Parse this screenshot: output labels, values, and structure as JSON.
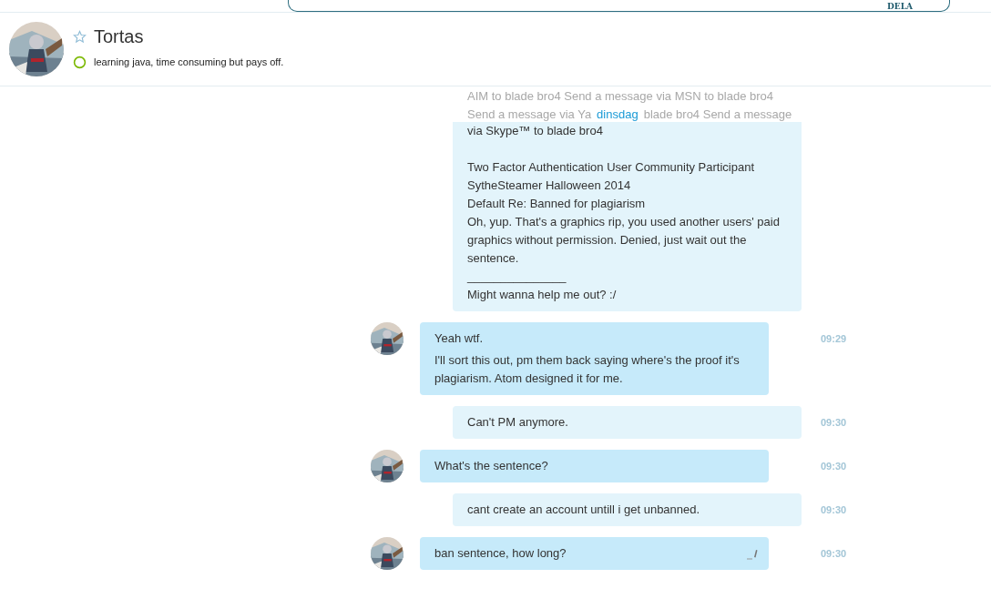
{
  "banner": {
    "text": "DELA"
  },
  "contact": {
    "name": "Tortas",
    "favorite": false,
    "status": "learning java, time consuming but pays off.",
    "online": true
  },
  "faded_lines": [
    "AIM to blade bro4 Send a message via MSN to blade bro4",
    "Send a message via Ya",
    "blade bro4 Send a message"
  ],
  "date_divider": "dinsdag",
  "messages": [
    {
      "kind": "outgoing",
      "paragraphs": [
        [
          "via Skype™ to blade bro4"
        ],
        [
          "Two Factor Authentication User Community Participant",
          "SytheSteamer Halloween 2014",
          "Default Re: Banned for plagiarism",
          "Oh, yup. That's a graphics rip, you used another users' paid graphics without permission. Denied, just wait out the sentence.",
          "_______________",
          "Might wanna help me out? :/"
        ]
      ],
      "edited": false
    },
    {
      "kind": "incoming",
      "paragraphs": [
        [
          "Yeah wtf."
        ],
        [
          "I'll sort this out, pm them back saying where's the proof it's plagiarism. Atom designed it for me."
        ]
      ],
      "time": "09:29",
      "edited": false
    },
    {
      "kind": "outgoing",
      "paragraphs": [
        [
          "Can't PM anymore."
        ]
      ],
      "time": "09:30",
      "edited": false
    },
    {
      "kind": "incoming",
      "paragraphs": [
        [
          "What's the sentence?"
        ]
      ],
      "time": "09:30",
      "edited": false
    },
    {
      "kind": "outgoing",
      "paragraphs": [
        [
          "cant create an account untill i get unbanned."
        ]
      ],
      "time": "09:30",
      "edited": false
    },
    {
      "kind": "incoming",
      "paragraphs": [
        [
          "ban sentence, how long?"
        ]
      ],
      "time": "09:30",
      "edited": true
    }
  ]
}
